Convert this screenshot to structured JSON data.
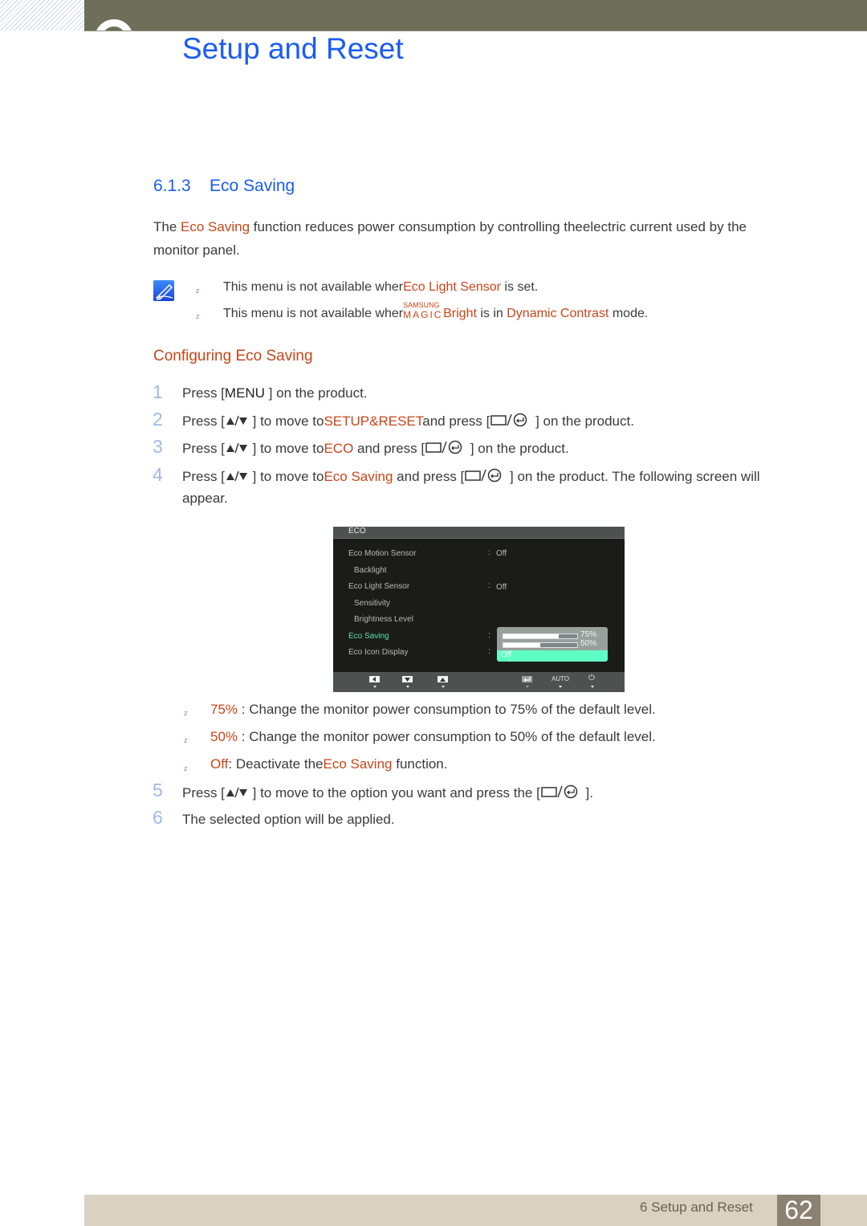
{
  "header": {
    "chapter_title": "Setup and Reset"
  },
  "section": {
    "number": "6.1.3",
    "title": "Eco Saving"
  },
  "intro": {
    "prefix": "The ",
    "highlight": "Eco Saving",
    "suffix_line1": "  function reduces power consumption by controlling theelectric current used by the",
    "line2": "monitor panel."
  },
  "notes": [
    {
      "prefix": "This menu is not available wher",
      "highlight": "Eco Light Sensor",
      "suffix": "  is set."
    },
    {
      "prefix": "This menu is not available wher",
      "brand_top": "SAMSUNG",
      "brand_bottom": "MAGIC",
      "highlight": "Bright",
      "middle": "  is in ",
      "highlight2": "Dynamic Contrast",
      "suffix": "  mode."
    }
  ],
  "subheading": "Configuring Eco Saving",
  "steps": [
    {
      "num": "1",
      "pre": "Press [",
      "key": "MENU",
      "post": " ] on the product."
    },
    {
      "num": "2",
      "pre": "Press [",
      "mid1": " ] to move to",
      "highlight": "SETUP&RESET",
      "mid2": "and press [",
      "post": " ] on the product."
    },
    {
      "num": "3",
      "pre": "Press [",
      "mid1": " ] to move to",
      "highlight": "ECO",
      "mid2": " and press [",
      "post": " ] on the product."
    },
    {
      "num": "4",
      "pre": "Press [",
      "mid1": " ] to move to",
      "highlight": "Eco Saving",
      "mid2": "  and press [",
      "post": " ] on the product. The following screen will",
      "line2": "appear."
    },
    {
      "num": "5",
      "pre": "Press [",
      "mid1": " ] to move to the opti",
      "mid1b": "on you want and press the [",
      "post": " ]."
    },
    {
      "num": "6",
      "text": "The selected option will be applied."
    }
  ],
  "osd": {
    "title": "ECO",
    "rows": [
      {
        "label": "Eco Motion Sensor",
        "value": "Off",
        "sub": false,
        "active": false
      },
      {
        "label": "Backlight",
        "value": "",
        "sub": true,
        "active": false
      },
      {
        "label": "Eco Light Sensor",
        "value": "Off",
        "sub": false,
        "active": false
      },
      {
        "label": "Sensitivity",
        "value": "",
        "sub": true,
        "active": false
      },
      {
        "label": "Brightness Level",
        "value": "",
        "sub": true,
        "active": false
      },
      {
        "label": "Eco Saving",
        "value": "",
        "sub": false,
        "active": true
      },
      {
        "label": "Eco Icon Display",
        "value": "",
        "sub": false,
        "active": false
      }
    ],
    "dropdown": {
      "options": [
        {
          "label": "75%",
          "level": 0.75
        },
        {
          "label": "50%",
          "level": 0.5
        },
        {
          "label": "Off",
          "selected": true
        }
      ]
    },
    "footer": {
      "auto_label": "AUTO"
    }
  },
  "options": [
    {
      "label": "75%",
      "desc": " : Change the monitor power consumption to 75% of the default level."
    },
    {
      "label": "50%",
      "desc": " : Change the monitor power consumption to 50% of the default level."
    },
    {
      "label": "Off",
      "desc": ": Deactivate the",
      "highlight": "Eco Saving",
      "suffix": "  function."
    }
  ],
  "footer": {
    "chapter_label": "6 Setup and Reset",
    "page_number": "62"
  },
  "colors": {
    "heading_blue": "#1a5cf5",
    "highlight_orange": "#c8461a",
    "osd_active": "#5ee0b0",
    "osd_selected": "#5effc4"
  }
}
